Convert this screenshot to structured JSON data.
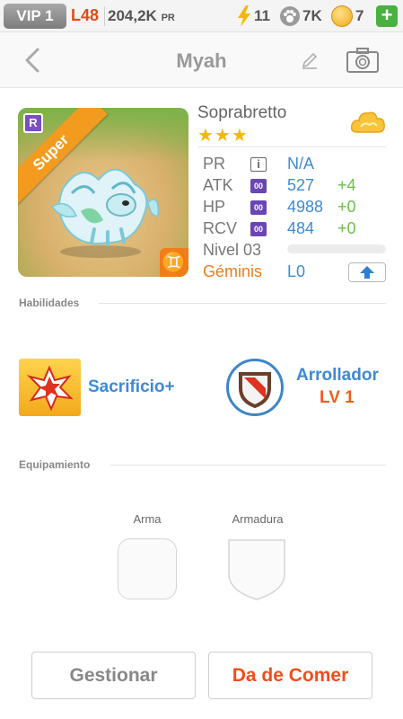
{
  "status_bar": {
    "vip": "VIP 1",
    "level": "L48",
    "power": "204,2K",
    "power_unit": "PR",
    "energy": "11",
    "food": "7K",
    "coins": "7",
    "add_label": "+"
  },
  "nav": {
    "title": "Myah"
  },
  "monster": {
    "rarity_tag": "Super",
    "rarity_letter": "R",
    "species": "Soprabretto",
    "stars": "★★★",
    "zodiac_symbol": "♊",
    "stats": [
      {
        "label": "PR",
        "value": "N/A",
        "bonus": ""
      },
      {
        "label": "ATK",
        "value": "527",
        "bonus": "+4"
      },
      {
        "label": "HP",
        "value": "4988",
        "bonus": "+0"
      },
      {
        "label": "RCV",
        "value": "484",
        "bonus": "+0"
      }
    ],
    "stat_badge": "00",
    "info_badge": "i",
    "level": "Nivel 03",
    "level_progress": 0,
    "zodiac": "Géminis",
    "zodiac_level": "L0"
  },
  "abilities": {
    "heading": "Habilidades",
    "skill": "Sacrificio+",
    "leader": "Arrollador",
    "leader_level": "LV 1"
  },
  "equipment": {
    "heading": "Equipamiento",
    "weapon": "Arma",
    "armor": "Armadura"
  },
  "buttons": {
    "manage": "Gestionar",
    "feed": "Da de Comer"
  },
  "colors": {
    "stat_value": "#3d8ad6",
    "bonus": "#6cc04a",
    "accent_orange": "#ef7d1a",
    "feed_button": "#ef4e1a"
  }
}
